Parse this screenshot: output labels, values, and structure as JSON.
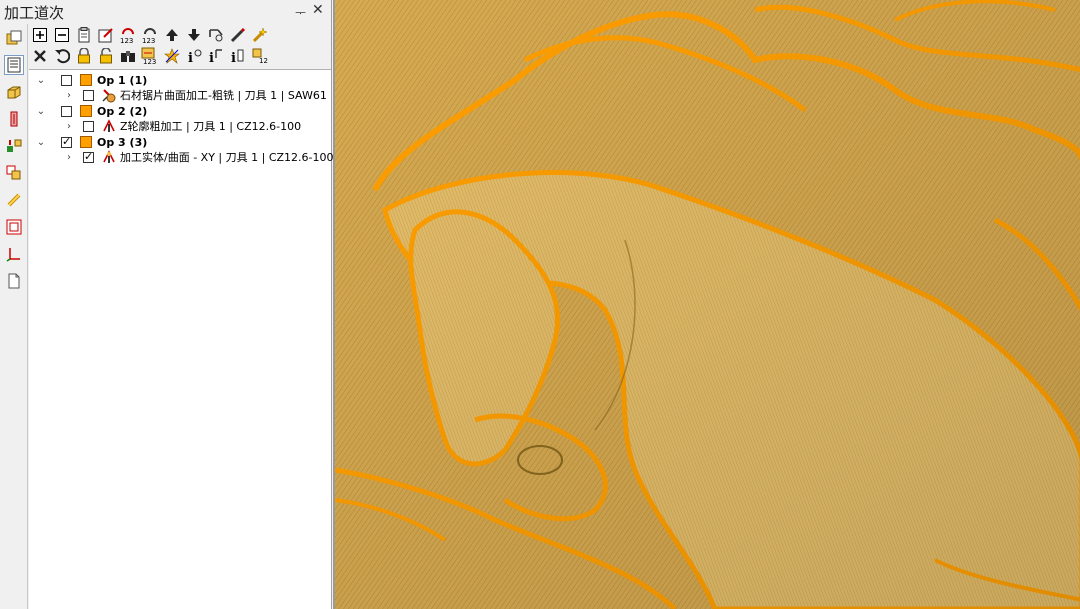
{
  "panel": {
    "title": "加工道次",
    "pin_glyph": "ᅮ",
    "close_glyph": "✕"
  },
  "toolbar_row1": [
    {
      "name": "add-icon"
    },
    {
      "name": "remove-icon"
    },
    {
      "name": "copy-icon"
    },
    {
      "name": "edit-icon"
    },
    {
      "name": "regenerate-123-icon"
    },
    {
      "name": "refresh-123-icon"
    },
    {
      "name": "move-up-icon"
    },
    {
      "name": "move-down-icon"
    },
    {
      "name": "link-icon"
    },
    {
      "name": "pencil-icon"
    },
    {
      "name": "wand-icon"
    }
  ],
  "toolbar_row2": [
    {
      "name": "delete-icon"
    },
    {
      "name": "undo-icon"
    },
    {
      "name": "lock-icon"
    },
    {
      "name": "unlock-icon"
    },
    {
      "name": "binoculars-icon"
    },
    {
      "name": "calc-123-icon"
    },
    {
      "name": "star-icon"
    },
    {
      "name": "info-icon"
    },
    {
      "name": "info-bracket-icon"
    },
    {
      "name": "info-tool-icon"
    },
    {
      "name": "number-12-icon"
    }
  ],
  "tree": {
    "ops": [
      {
        "label": "Op 1 (1)",
        "checked": false,
        "children": [
          {
            "label": "石材锯片曲面加工-粗铣 | 刀具 1 | SAW61",
            "checked": false
          }
        ]
      },
      {
        "label": "Op 2 (2)",
        "checked": false,
        "children": [
          {
            "label": "Z轮廓粗加工 | 刀具 1 | CZ12.6-100",
            "checked": false
          }
        ]
      },
      {
        "label": "Op 3 (3)",
        "checked": true,
        "children": [
          {
            "label": "加工实体/曲面 - XY | 刀具 1 | CZ12.6-100",
            "checked": true
          }
        ]
      }
    ]
  },
  "colors": {
    "op_orange": "#ffa000",
    "toolpath_orange": "#ff9f00",
    "relief_base": "#d4a74c"
  },
  "viewport": {
    "content": "toolpath-relief-preview"
  }
}
